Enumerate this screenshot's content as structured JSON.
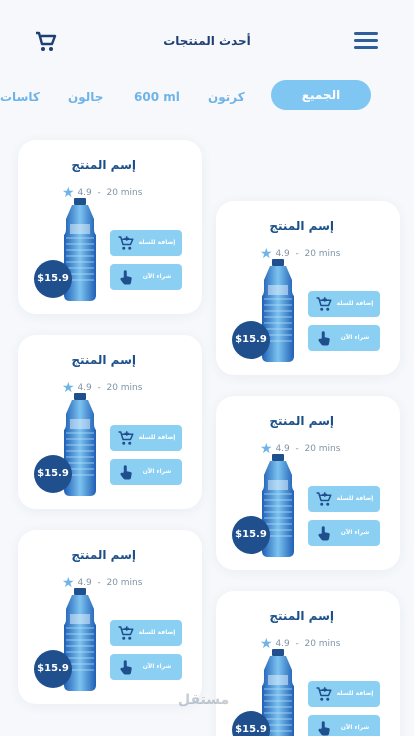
{
  "header": {
    "title": "أحدث المنتجات",
    "cart_icon": "cart-icon",
    "menu_icon": "menu-icon"
  },
  "tabs": [
    {
      "label": "الجميع",
      "active": true
    },
    {
      "label": "كرتون",
      "active": false
    },
    {
      "label": "600 ml",
      "active": false
    },
    {
      "label": "جالون",
      "active": false
    },
    {
      "label": "كاسات",
      "active": false
    }
  ],
  "products": [
    {
      "name": "إسم المنتج",
      "rating": "4.9",
      "time": "20 mins",
      "price": "$15.9",
      "add_to_cart": "إضافة للسلة",
      "buy_now": "شراء الآن"
    },
    {
      "name": "إسم المنتج",
      "rating": "4.9",
      "time": "20 mins",
      "price": "$15.9",
      "add_to_cart": "إضافة للسلة",
      "buy_now": "شراء الآن"
    },
    {
      "name": "إسم المنتج",
      "rating": "4.9",
      "time": "20 mins",
      "price": "$15.9",
      "add_to_cart": "إضافة للسلة",
      "buy_now": "شراء الآن"
    },
    {
      "name": "إسم المنتج",
      "rating": "4.9",
      "time": "20 mins",
      "price": "$15.9",
      "add_to_cart": "إضافة للسلة",
      "buy_now": "شراء الآن"
    },
    {
      "name": "إسم المنتج",
      "rating": "4.9",
      "time": "20 mins",
      "price": "$15.9",
      "add_to_cart": "إضافة للسلة",
      "buy_now": "شراء الآن"
    },
    {
      "name": "إسم المنتج",
      "rating": "4.9",
      "time": "20 mins",
      "price": "$15.9",
      "add_to_cart": "إضافة للسلة",
      "buy_now": "شراء الآن"
    }
  ],
  "watermark": "مستقل",
  "colors": {
    "accent": "#7fc6f2",
    "primary": "#1f4f8d",
    "button": "#8bd0f3"
  }
}
